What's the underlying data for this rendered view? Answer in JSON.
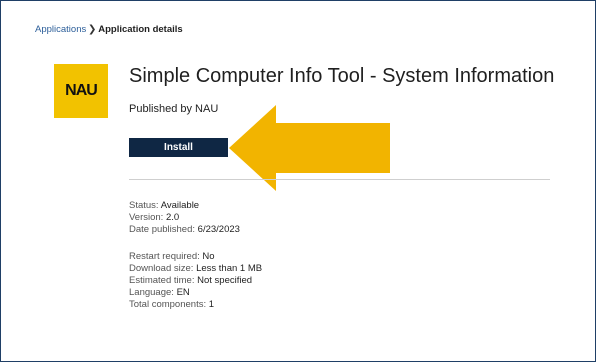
{
  "breadcrumb": {
    "parent": "Applications",
    "separator": "❯",
    "current": "Application details"
  },
  "app": {
    "logo_text": "NAU",
    "title": "Simple Computer Info Tool - System Information",
    "publisher": "Published by NAU",
    "install_label": "Install"
  },
  "details": {
    "status_label": "Status:",
    "status_value": "Available",
    "version_label": "Version:",
    "version_value": "2.0",
    "date_label": "Date published:",
    "date_value": "6/23/2023",
    "restart_label": "Restart required:",
    "restart_value": "No",
    "download_label": "Download size:",
    "download_value": "Less than 1 MB",
    "time_label": "Estimated time:",
    "time_value": "Not specified",
    "language_label": "Language:",
    "language_value": "EN",
    "components_label": "Total components:",
    "components_value": "1"
  },
  "colors": {
    "frame_border": "#1f3f66",
    "link": "#2d5f9a",
    "logo_bg": "#f2c200",
    "install_bg": "#0f2744",
    "arrow": "#f2b400"
  },
  "icons": {
    "breadcrumb_separator": "chevron-right-icon",
    "annotation": "arrow-left-icon"
  }
}
